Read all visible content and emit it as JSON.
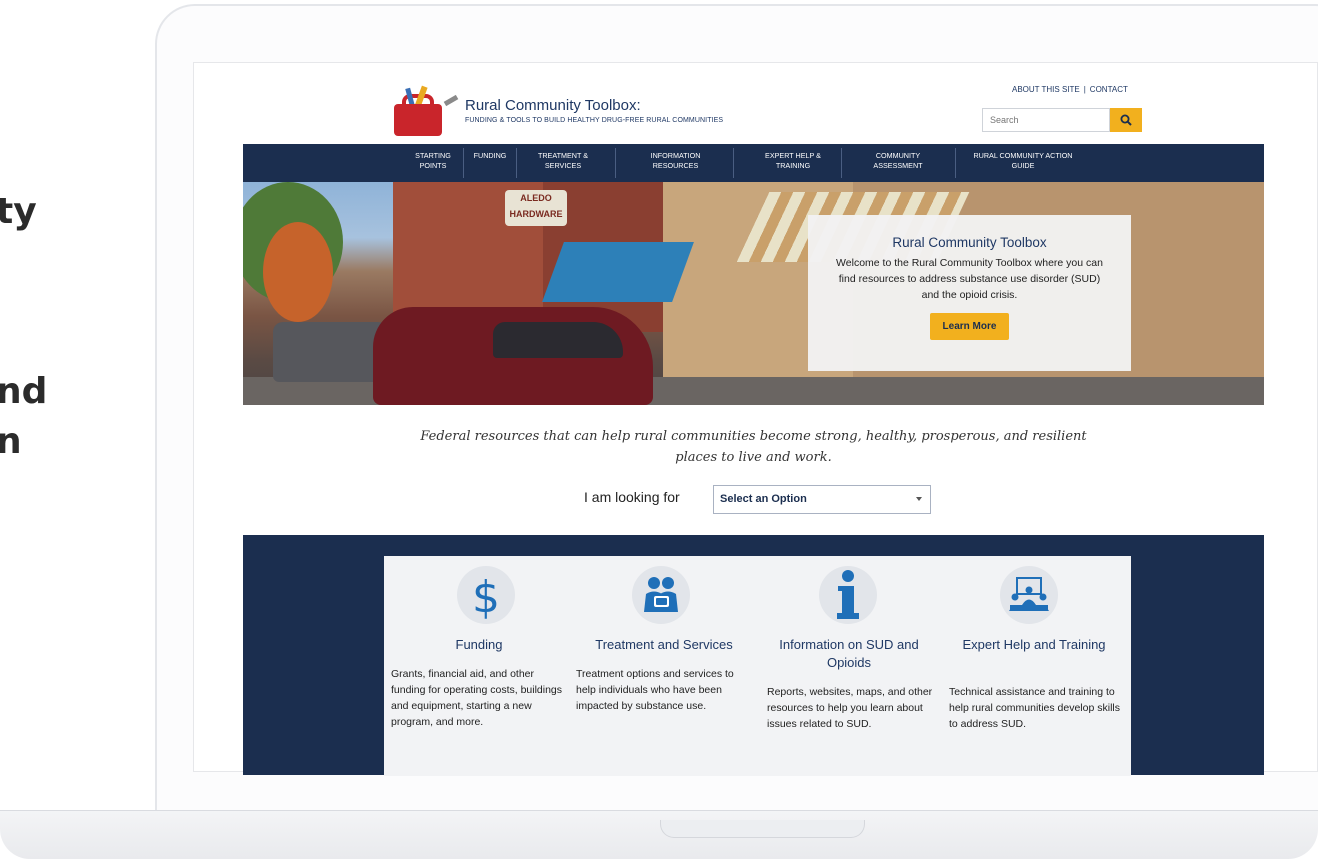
{
  "side_text": {
    "line1": "ty",
    "line2": "nd",
    "line3": "n"
  },
  "header": {
    "site_title": "Rural Community Toolbox:",
    "tagline": "FUNDING & TOOLS TO BUILD HEALTHY DRUG-FREE RURAL COMMUNITIES",
    "about_link": "ABOUT THIS SITE",
    "separator": "|",
    "contact_link": "CONTACT",
    "search_placeholder": "Search"
  },
  "nav": {
    "items": [
      {
        "label1": "STARTING",
        "label2": "POINTS"
      },
      {
        "label1": "FUNDING",
        "label2": ""
      },
      {
        "label1": "TREATMENT &",
        "label2": "SERVICES"
      },
      {
        "label1": "INFORMATION",
        "label2": "RESOURCES"
      },
      {
        "label1": "EXPERT HELP &",
        "label2": "TRAINING"
      },
      {
        "label1": "COMMUNITY",
        "label2": "ASSESSMENT"
      },
      {
        "label1": "RURAL COMMUNITY ACTION",
        "label2": "GUIDE"
      }
    ]
  },
  "hero": {
    "sign_line1": "ALEDO",
    "sign_line2": "HARDWARE",
    "card_title": "Rural Community Toolbox",
    "card_text": "Welcome to the Rural Community Toolbox where you can find resources to address substance use disorder (SUD) and the opioid crisis.",
    "button_label": "Learn More"
  },
  "intro": {
    "text_line1": "Federal resources that can help rural communities become strong, healthy, prosperous, and resilient",
    "text_line2": "places to live and work.",
    "looking_label": "I am looking for",
    "select_value": "Select an Option"
  },
  "categories": [
    {
      "icon": "dollar-icon",
      "title": "Funding",
      "desc": "Grants, financial aid, and other funding for operating costs, buildings and equipment, starting a new program, and more."
    },
    {
      "icon": "people-icon",
      "title": "Treatment and Services",
      "desc": "Treatment options and services to help individuals who have been impacted by substance use."
    },
    {
      "icon": "info-icon",
      "title": "Information on SUD and Opioids",
      "desc": "Reports, websites, maps, and other resources to help you learn about issues related to SUD."
    },
    {
      "icon": "presentation-icon",
      "title": "Expert Help and Training",
      "desc": "Technical assistance and training to help rural communities develop skills to address SUD."
    }
  ],
  "colors": {
    "navy": "#1b2e4f",
    "accent_yellow": "#f2b01e",
    "icon_blue": "#1f6fb8",
    "toolbox_red": "#c9252b"
  }
}
